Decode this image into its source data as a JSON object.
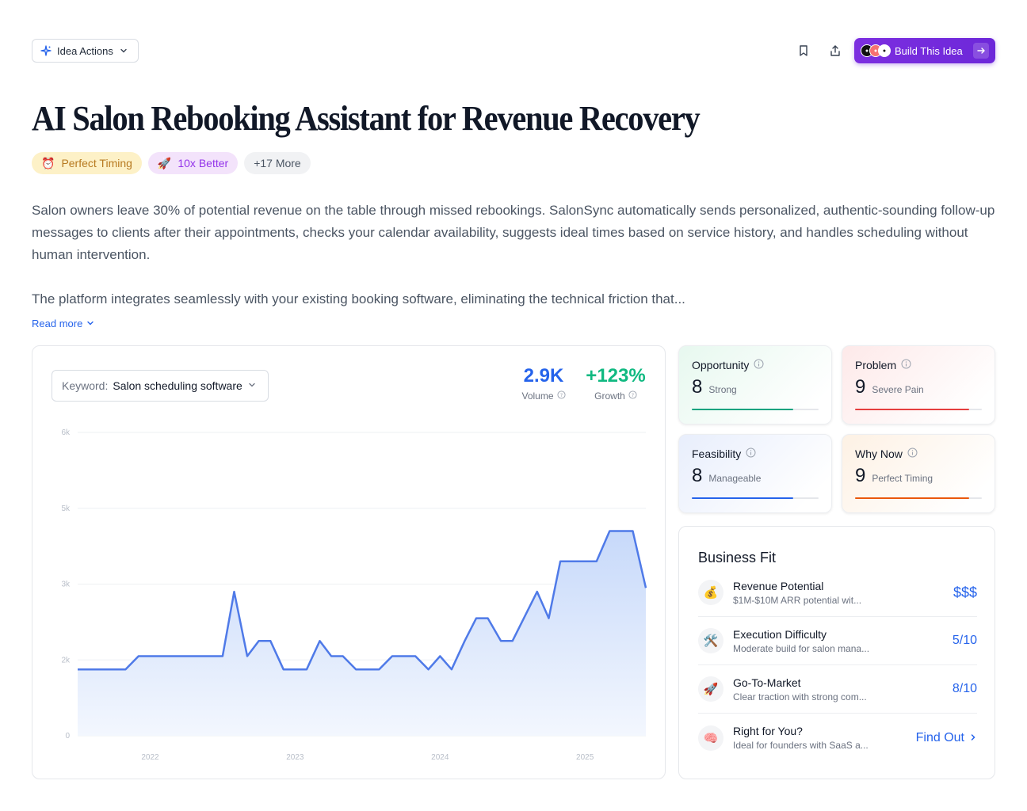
{
  "header": {
    "idea_actions_label": "Idea Actions",
    "build_label": "Build This Idea",
    "logos": [
      "a",
      "b",
      "c"
    ]
  },
  "title": "AI Salon Rebooking Assistant for Revenue Recovery",
  "tags": [
    {
      "icon": "⏰",
      "label": "Perfect Timing"
    },
    {
      "icon": "🚀",
      "label": "10x Better"
    },
    {
      "label": "+17 More"
    }
  ],
  "description": {
    "p1": "Salon owners leave 30% of potential revenue on the table through missed rebookings. SalonSync automatically sends personalized, authentic-sounding follow-up messages to clients after their appointments, checks your calendar availability, suggests ideal times based on service history, and handles scheduling without human intervention.",
    "p2": "The platform integrates seamlessly with your existing booking software, eliminating the technical friction that...",
    "read_more": "Read more"
  },
  "trend": {
    "keyword_label": "Keyword:",
    "keyword_value": "Salon scheduling software",
    "volume": {
      "value": "2.9K",
      "label": "Volume",
      "color": "#2563eb"
    },
    "growth": {
      "value": "+123%",
      "label": "Growth",
      "color": "#10b981"
    }
  },
  "chart_data": {
    "type": "area",
    "yticks": [
      "0",
      "2k",
      "3k",
      "5k",
      "6k"
    ],
    "ylim": [
      0,
      6000
    ],
    "xticks": [
      "2022",
      "2023",
      "2024",
      "2025"
    ],
    "x_range": [
      2021.5,
      2025.42
    ],
    "series": [
      {
        "color": "#4f7ae8",
        "points": [
          [
            2021.5,
            1750
          ],
          [
            2021.83,
            1750
          ],
          [
            2021.92,
            2050
          ],
          [
            2022.5,
            2050
          ],
          [
            2022.58,
            2900
          ],
          [
            2022.67,
            2050
          ],
          [
            2022.75,
            2250
          ],
          [
            2022.83,
            2250
          ],
          [
            2022.92,
            1750
          ],
          [
            2023.08,
            1750
          ],
          [
            2023.17,
            2250
          ],
          [
            2023.25,
            2050
          ],
          [
            2023.33,
            2050
          ],
          [
            2023.42,
            1750
          ],
          [
            2023.58,
            1750
          ],
          [
            2023.67,
            2050
          ],
          [
            2023.83,
            2050
          ],
          [
            2023.92,
            1750
          ],
          [
            2024.0,
            2050
          ],
          [
            2024.08,
            1750
          ],
          [
            2024.17,
            2250
          ],
          [
            2024.25,
            2550
          ],
          [
            2024.33,
            2550
          ],
          [
            2024.42,
            2250
          ],
          [
            2024.5,
            2250
          ],
          [
            2024.67,
            2900
          ],
          [
            2024.75,
            2550
          ],
          [
            2024.83,
            3600
          ],
          [
            2025.08,
            3600
          ],
          [
            2025.17,
            4400
          ],
          [
            2025.33,
            4400
          ],
          [
            2025.42,
            2950
          ]
        ]
      }
    ]
  },
  "scores": [
    {
      "name": "Opportunity",
      "value": "8",
      "sub": "Strong",
      "pct": 0.8,
      "color": "#10a37f",
      "bg": "#e7f8ef"
    },
    {
      "name": "Problem",
      "value": "9",
      "sub": "Severe Pain",
      "pct": 0.9,
      "color": "#e53e3e",
      "bg": "#fde9e9"
    },
    {
      "name": "Feasibility",
      "value": "8",
      "sub": "Manageable",
      "pct": 0.8,
      "color": "#2563eb",
      "bg": "#e8eefc"
    },
    {
      "name": "Why Now",
      "value": "9",
      "sub": "Perfect Timing",
      "pct": 0.9,
      "color": "#ea580c",
      "bg": "#fdf1e4"
    }
  ],
  "business_fit": {
    "title": "Business Fit",
    "rows": [
      {
        "icon": "💰",
        "name": "Revenue Potential",
        "desc": "$1M-$10M ARR potential wit...",
        "value": "$$$"
      },
      {
        "icon": "🛠️",
        "name": "Execution Difficulty",
        "desc": "Moderate build for salon mana...",
        "value": "5/10"
      },
      {
        "icon": "🚀",
        "name": "Go-To-Market",
        "desc": "Clear traction with strong com...",
        "value": "8/10"
      },
      {
        "icon": "🧠",
        "name": "Right for You?",
        "desc": "Ideal for founders with SaaS a...",
        "value": "Find Out"
      }
    ]
  }
}
